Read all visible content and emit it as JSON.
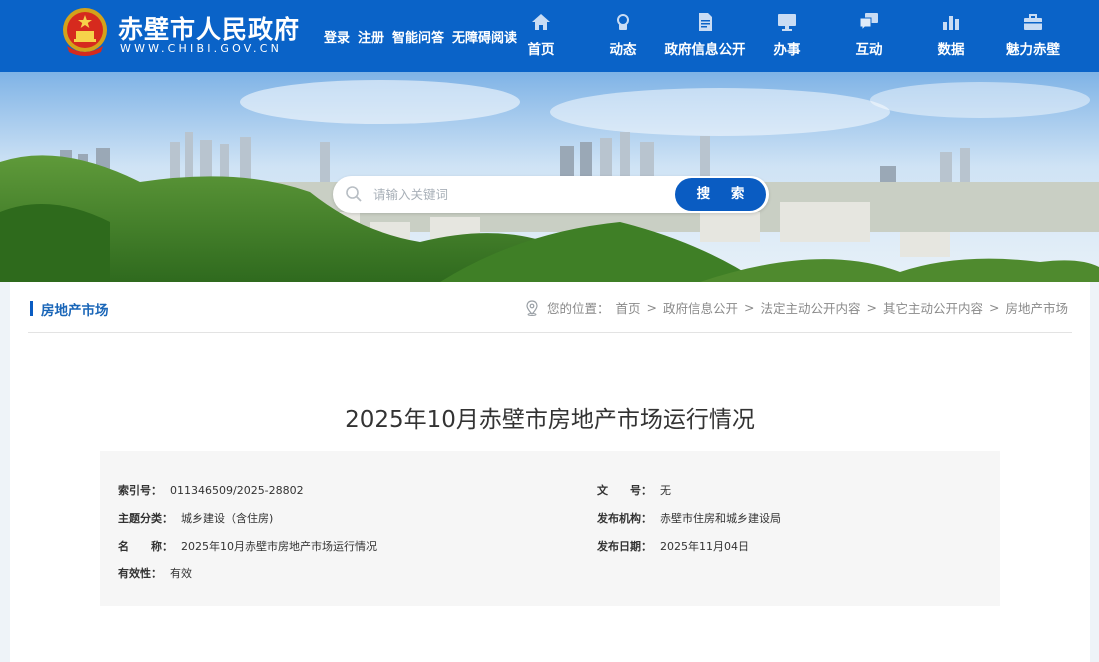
{
  "header": {
    "site_title": "赤壁市人民政府",
    "site_domain": "WWW.CHIBI.GOV.CN",
    "util_links": [
      "登录",
      "注册",
      "智能问答",
      "无障碍阅读"
    ],
    "nav": [
      {
        "label": "首页",
        "icon": "home-icon"
      },
      {
        "label": "动态",
        "icon": "news-icon"
      },
      {
        "label": "政府信息公开",
        "icon": "document-icon"
      },
      {
        "label": "办事",
        "icon": "monitor-icon"
      },
      {
        "label": "互动",
        "icon": "chat-icon"
      },
      {
        "label": "数据",
        "icon": "bar-chart-icon"
      },
      {
        "label": "魅力赤壁",
        "icon": "briefcase-icon"
      }
    ]
  },
  "search": {
    "placeholder": "请输入关键词",
    "button_label": "搜 索"
  },
  "section": {
    "title": "房地产市场"
  },
  "breadcrumb": {
    "prefix": "您的位置：",
    "items": [
      "首页",
      "政府信息公开",
      "法定主动公开内容",
      "其它主动公开内容",
      "房地产市场"
    ],
    "separator": ">"
  },
  "document": {
    "title": "2025年10月赤壁市房地产市场运行情况",
    "meta_left": [
      {
        "key": "索引号：",
        "value": "011346509/2025-28802"
      },
      {
        "key": "主题分类：",
        "value": "城乡建设（含住房)"
      },
      {
        "key": "名　　称：",
        "value": "2025年10月赤壁市房地产市场运行情况"
      },
      {
        "key": "有效性：",
        "value": "有效"
      }
    ],
    "meta_right": [
      {
        "key": "文　　号：",
        "value": "无"
      },
      {
        "key": "发布机构：",
        "value": "赤壁市住房和城乡建设局"
      },
      {
        "key": "发布日期：",
        "value": "2025年11月04日"
      }
    ]
  },
  "colors": {
    "header_blue": "#0a63c8",
    "accent_blue": "#0a5cc2",
    "section_title": "#1a66b8"
  }
}
